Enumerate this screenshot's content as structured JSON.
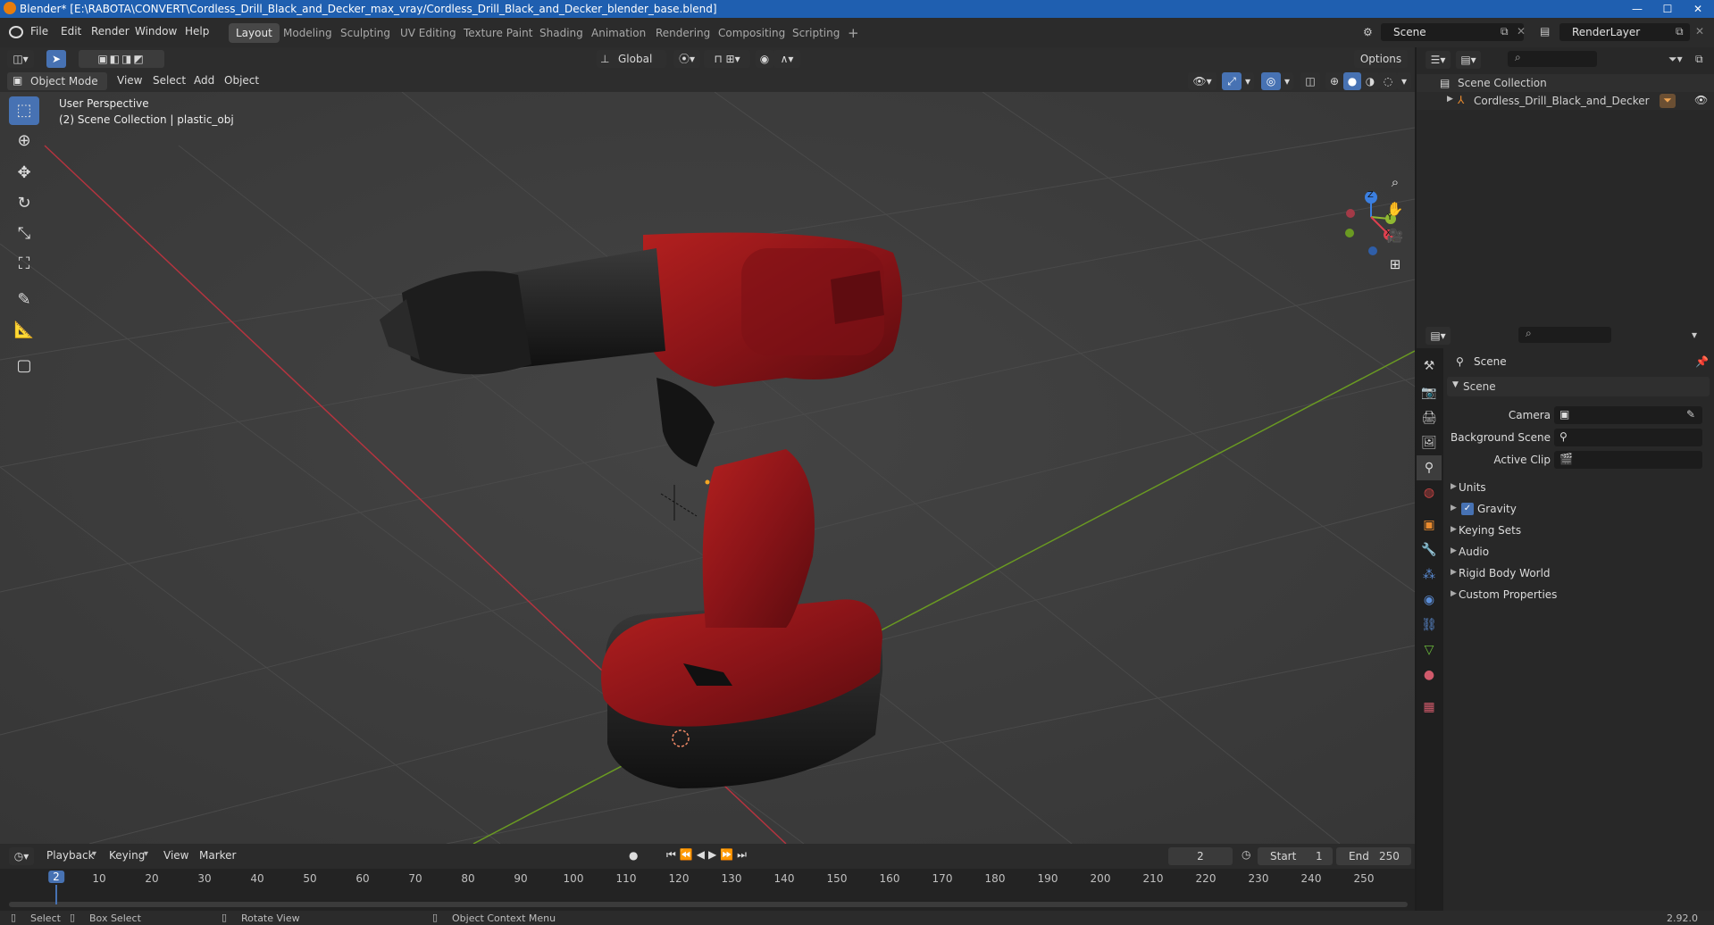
{
  "window": {
    "title": "Blender* [E:\\RABOTA\\CONVERT\\Cordless_Drill_Black_and_Decker_max_vray/Cordless_Drill_Black_and_Decker_blender_base.blend]",
    "minimize": "—",
    "maximize": "☐",
    "close": "✕"
  },
  "menu": [
    "File",
    "Edit",
    "Render",
    "Window",
    "Help"
  ],
  "workspaces": [
    "Layout",
    "Modeling",
    "Sculpting",
    "UV Editing",
    "Texture Paint",
    "Shading",
    "Animation",
    "Rendering",
    "Compositing",
    "Scripting"
  ],
  "add_workspace": "+",
  "scene_field": "Scene",
  "renderlayer_field": "RenderLayer",
  "header": {
    "orientation": "Global",
    "options": "Options"
  },
  "viewport_menu": {
    "mode": "Object Mode",
    "view": "View",
    "select": "Select",
    "add": "Add",
    "object": "Object"
  },
  "viewport": {
    "perspective": "User Perspective",
    "collection_info": "(2) Scene Collection | plastic_obj"
  },
  "gizmo": {
    "z": "Z",
    "y": "Y",
    "x": "X"
  },
  "outliner": {
    "root": "Scene Collection",
    "item": "Cordless_Drill_Black_and_Decker"
  },
  "properties": {
    "context": "Scene",
    "panel": "Scene",
    "camera_label": "Camera",
    "background_label": "Background Scene",
    "clip_label": "Active Clip",
    "sections": [
      "Units",
      "Gravity",
      "Keying Sets",
      "Audio",
      "Rigid Body World",
      "Custom Properties"
    ],
    "gravity_checked": true
  },
  "timeline": {
    "playback": "Playback",
    "keying": "Keying",
    "view": "View",
    "marker": "Marker",
    "current_frame": "2",
    "start_label": "Start",
    "start": "1",
    "end_label": "End",
    "end": "250",
    "ticks": [
      "2",
      "10",
      "20",
      "30",
      "40",
      "50",
      "60",
      "70",
      "80",
      "90",
      "100",
      "110",
      "120",
      "130",
      "140",
      "150",
      "160",
      "170",
      "180",
      "190",
      "200",
      "210",
      "220",
      "230",
      "240",
      "250"
    ]
  },
  "status": {
    "select": "Select",
    "box_select": "Box Select",
    "rotate": "Rotate View",
    "context_menu": "Object Context Menu",
    "version": "2.92.0"
  },
  "colors": {
    "accent": "#4772b3",
    "drill_red": "#8e1418",
    "axis_x": "#b4343f",
    "axis_y": "#6a9a22"
  }
}
